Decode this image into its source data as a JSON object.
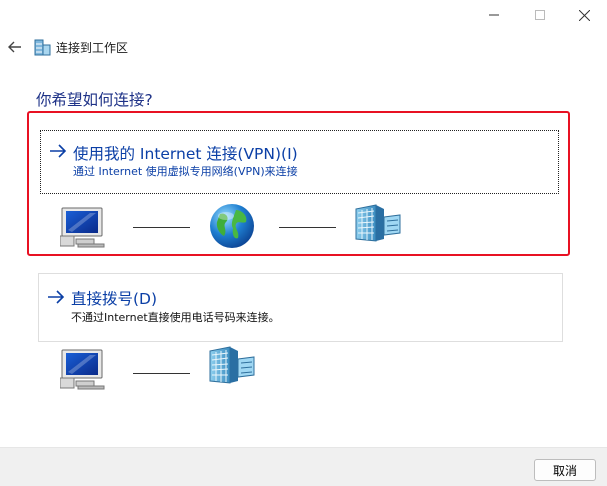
{
  "window": {
    "controls": [
      "minimize",
      "maximize",
      "close"
    ]
  },
  "header": {
    "back_icon": "arrow-left-icon",
    "title": "连接到工作区",
    "icon": "workplace-network-icon"
  },
  "question": "你希望如何连接?",
  "options": [
    {
      "title": "使用我的 Internet 连接(VPN)(I)",
      "description": "通过 Internet 使用虚拟专用网络(VPN)来连接",
      "icons": [
        "computer-icon",
        "globe-icon",
        "server-icon"
      ],
      "highlighted": true
    },
    {
      "title": "直接拨号(D)",
      "description": "不通过Internet直接使用电话号码来连接。",
      "icons": [
        "computer-icon",
        "server-icon"
      ],
      "highlighted": false
    }
  ],
  "footer": {
    "cancel_label": "取消"
  },
  "colors": {
    "link_blue": "#0b3fa6",
    "heading_blue": "#1e3287",
    "highlight_red": "#e81123"
  }
}
